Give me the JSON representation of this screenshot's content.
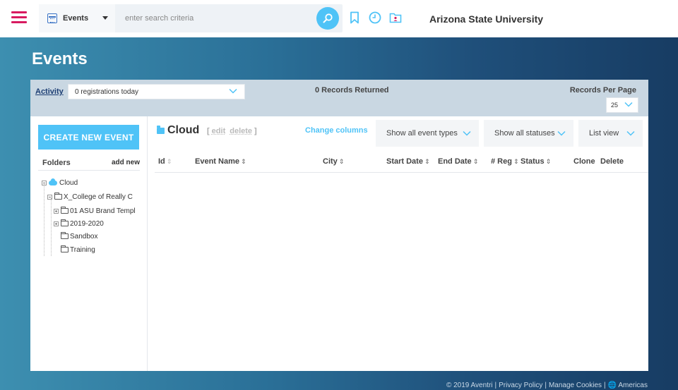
{
  "topbar": {
    "scope_label": "Events",
    "search_placeholder": "enter search criteria",
    "org_name": "Arizona State University",
    "icons": [
      "menu-icon",
      "calendar-icon",
      "search-icon",
      "bookmark-icon",
      "clock-icon",
      "folder-user-icon"
    ]
  },
  "page": {
    "title": "Events"
  },
  "filterbar": {
    "activity_label": "Activity",
    "activity_value": "0 registrations today",
    "records_returned": "0 Records Returned",
    "records_per_page_label": "Records Per Page",
    "records_per_page_value": "25"
  },
  "sidebar": {
    "create_button": "CREATE NEW EVENT",
    "folders_label": "Folders",
    "add_new": "add new",
    "tree": [
      {
        "label": "Cloud",
        "level": 0,
        "toggle": "minus",
        "icon": "cloud"
      },
      {
        "label": "X_College of Really C",
        "level": 1,
        "toggle": "minus",
        "icon": "folder"
      },
      {
        "label": "01 ASU Brand Templ",
        "level": 2,
        "toggle": "plus",
        "icon": "folder"
      },
      {
        "label": "2019-2020",
        "level": 2,
        "toggle": "plus",
        "icon": "folder"
      },
      {
        "label": "Sandbox",
        "level": 2,
        "toggle": "none",
        "icon": "folder"
      },
      {
        "label": "Training",
        "level": 2,
        "toggle": "none",
        "icon": "folder"
      }
    ]
  },
  "content": {
    "folder_title": "Cloud",
    "edit_label": "edit",
    "delete_label": "delete",
    "change_columns": "Change columns",
    "event_types": "Show all event types",
    "statuses": "Show all statuses",
    "view_mode": "List view",
    "columns": [
      "Id",
      "Event Name",
      "City",
      "Start Date",
      "End Date",
      "# Reg",
      "Status",
      "Clone",
      "Delete"
    ]
  },
  "footer": {
    "copyright": "© 2019 Aventri",
    "privacy": "Privacy Policy",
    "cookies": "Manage Cookies",
    "region": "Americas"
  },
  "colors": {
    "accent": "#4fc3f7",
    "menu": "#d81b60",
    "filterbar": "#c9d7e2"
  }
}
